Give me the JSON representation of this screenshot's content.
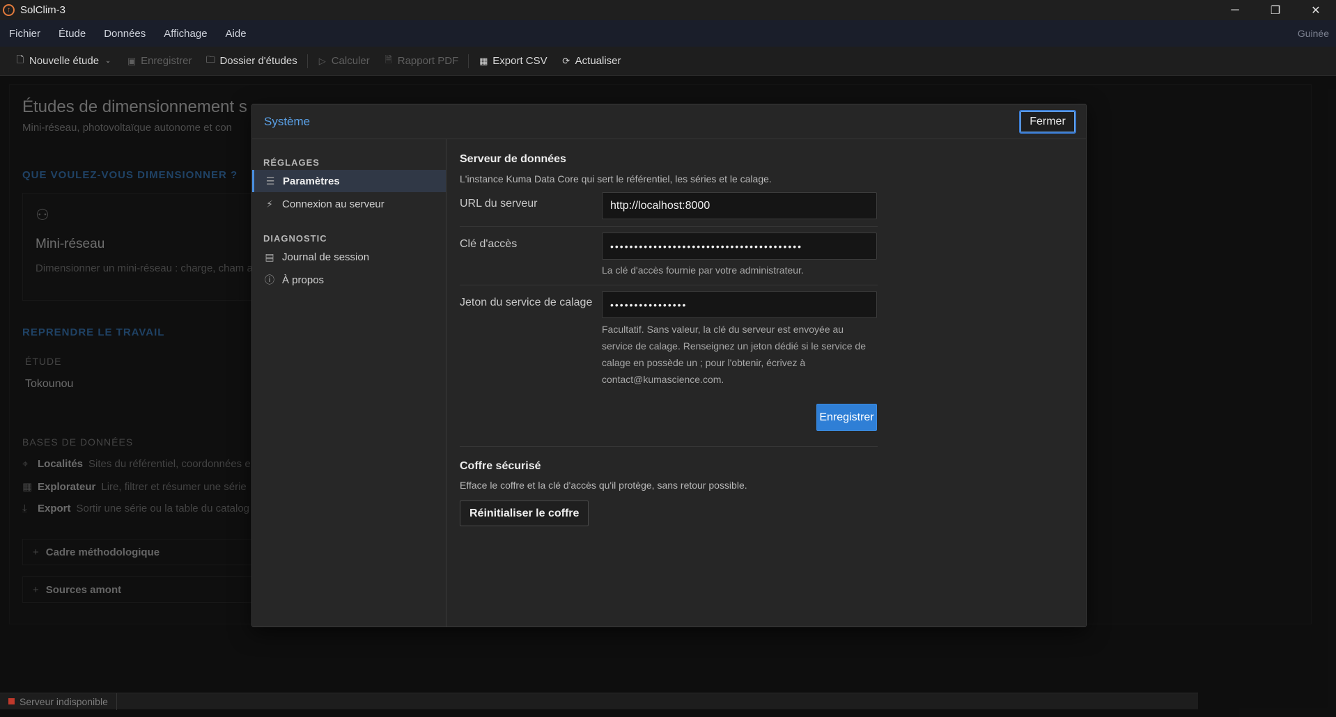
{
  "app": {
    "title": "SolClim-3"
  },
  "window_controls": {
    "minimize": "─",
    "restore": "❐",
    "close": "✕"
  },
  "menu": {
    "items": [
      "Fichier",
      "Étude",
      "Données",
      "Affichage",
      "Aide"
    ],
    "right": "Guinée"
  },
  "toolbar": {
    "new_study": "Nouvelle étude",
    "save": "Enregistrer",
    "studies_folder": "Dossier d'études",
    "compute": "Calculer",
    "pdf_report": "Rapport PDF",
    "export_csv": "Export CSV",
    "refresh": "Actualiser"
  },
  "background": {
    "title": "Études de dimensionnement s",
    "subtitle": "Mini-réseau, photovoltaïque autonome et con",
    "section_dimension": "QUE VOULEZ-VOUS DIMENSIONNER ?",
    "card": {
      "title": "Mini-réseau",
      "desc": "Dimensionner un mini-réseau : charge, cham appoint."
    },
    "section_resume": "REPRENDRE LE TRAVAIL",
    "study_label": "ÉTUDE",
    "study_value": "Tokounou",
    "db_label": "BASES DE DONNÉES",
    "db_rows": [
      {
        "name": "Localités",
        "desc": "Sites du référentiel, coordonnées e"
      },
      {
        "name": "Explorateur",
        "desc": "Lire, filtrer et résumer une série"
      },
      {
        "name": "Export",
        "desc": "Sortir une série ou la table du catalog"
      }
    ],
    "collapsibles": [
      "Cadre méthodologique",
      "Sources amont"
    ]
  },
  "status": {
    "server": "Serveur indisponible",
    "server_color": "#c0392b"
  },
  "dialog": {
    "title": "Système",
    "close_label": "Fermer",
    "sidebar": {
      "section_settings": "RÉGLAGES",
      "item_parameters": "Paramètres",
      "item_connection": "Connexion au serveur",
      "section_diagnostic": "DIAGNOSTIC",
      "item_journal": "Journal de session",
      "item_about": "À propos"
    },
    "data_server": {
      "title": "Serveur de données",
      "desc": "L'instance Kuma Data Core qui sert le référentiel, les séries et le calage.",
      "url_label": "URL du serveur",
      "url_value": "http://localhost:8000",
      "key_label": "Clé d'accès",
      "key_value": "••••••••••••••••••••••••••••••••••••••••",
      "key_help": "La clé d'accès fournie par votre administrateur.",
      "token_label": "Jeton du service de calage",
      "token_value": "••••••••••••••••",
      "token_help": "Facultatif. Sans valeur, la clé du serveur est envoyée au service de calage. Renseignez un jeton dédié si le service de calage en possède un ; pour l'obtenir, écrivez à contact@kumascience.com.",
      "save_label": "Enregistrer"
    },
    "vault": {
      "title": "Coffre sécurisé",
      "desc": "Efface le coffre et la clé d'accès qu'il protège, sans retour possible.",
      "reset_label": "Réinitialiser le coffre"
    }
  },
  "colors": {
    "accent": "#2f7fd6",
    "title_accent": "#5aa0e6",
    "section_blue": "#3a78b8"
  }
}
